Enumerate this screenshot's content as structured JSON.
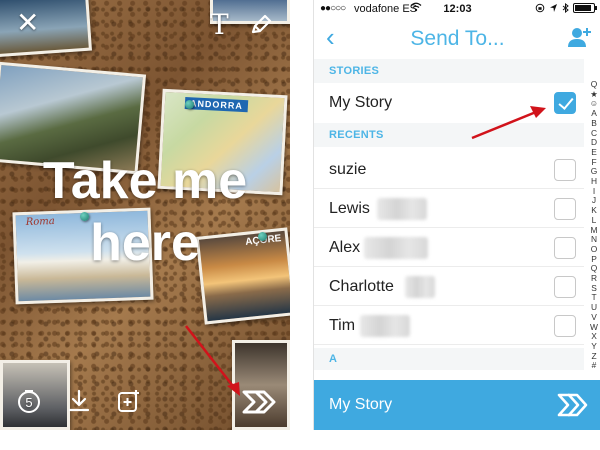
{
  "editor": {
    "caption": "Take me here",
    "photo_tags": {
      "andorra": "ANDORRA",
      "roma": "Roma",
      "acores": "AÇORE"
    },
    "icons": {
      "close": "close-icon",
      "text": "text-tool-icon",
      "pencil": "pencil-icon",
      "timer": "timer-icon",
      "timer_value": "5",
      "download": "download-icon",
      "story_add": "add-to-story-icon",
      "send": "send-arrow-icon"
    },
    "annotation_color": "#d1131b"
  },
  "send_to": {
    "status_bar": {
      "signal": "●●○○○",
      "carrier": "vodafone ES",
      "time": "12:03"
    },
    "nav": {
      "back_icon": "‹",
      "title": "Send To...",
      "add_friend_icon": "add-friend-icon"
    },
    "sections": {
      "stories": "STORIES",
      "recents": "RECENTS",
      "a": "A"
    },
    "stories": [
      {
        "name": "My Story",
        "checked": true
      }
    ],
    "recents": [
      {
        "name": "suzie",
        "checked": false,
        "surname_hidden": false
      },
      {
        "name": "Lewis",
        "checked": false,
        "surname_hidden": true
      },
      {
        "name": "Alex",
        "checked": false,
        "surname_hidden": true
      },
      {
        "name": "Charlotte",
        "checked": false,
        "surname_hidden": true
      },
      {
        "name": "Tim",
        "checked": false,
        "surname_hidden": true
      }
    ],
    "index_letters": [
      "Q",
      "★",
      "☺",
      "A",
      "B",
      "C",
      "D",
      "E",
      "F",
      "G",
      "H",
      "I",
      "J",
      "K",
      "L",
      "M",
      "N",
      "O",
      "P",
      "Q",
      "R",
      "S",
      "T",
      "U",
      "V",
      "W",
      "X",
      "Y",
      "Z",
      "#"
    ],
    "send_bar": {
      "label": "My Story",
      "icon": "send-arrow-icon"
    },
    "accent_color": "#3fa9e0"
  }
}
